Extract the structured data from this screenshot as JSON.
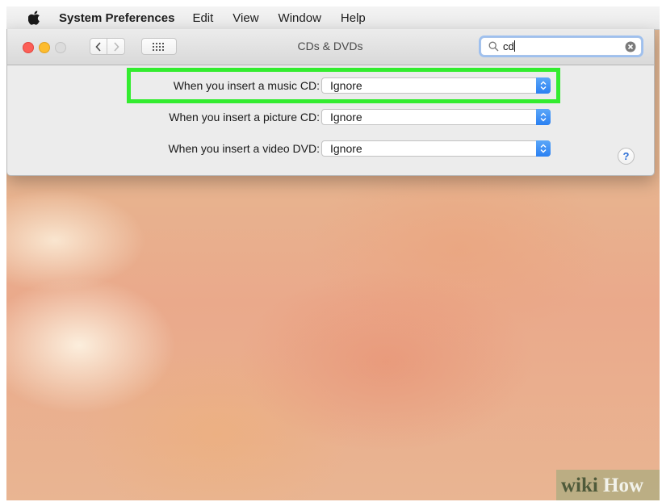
{
  "menubar": {
    "app_name": "System Preferences",
    "items": [
      "Edit",
      "View",
      "Window",
      "Help"
    ]
  },
  "window": {
    "title": "CDs & DVDs",
    "search": {
      "value": "cd"
    }
  },
  "settings": [
    {
      "label": "When you insert a music CD:",
      "value": "Ignore"
    },
    {
      "label": "When you insert a picture CD:",
      "value": "Ignore"
    },
    {
      "label": "When you insert a video DVD:",
      "value": "Ignore"
    }
  ],
  "help_label": "?",
  "watermark": {
    "text": "wikiHow"
  },
  "colors": {
    "highlight": "#33ec2f",
    "select_accent": "#2a80f2",
    "close": "#fc5f57",
    "minimize": "#fdbc2e"
  },
  "icons": [
    "apple-icon",
    "back-icon",
    "forward-icon",
    "grid-icon",
    "search-icon",
    "clear-icon",
    "stepper-icon",
    "help-icon"
  ]
}
